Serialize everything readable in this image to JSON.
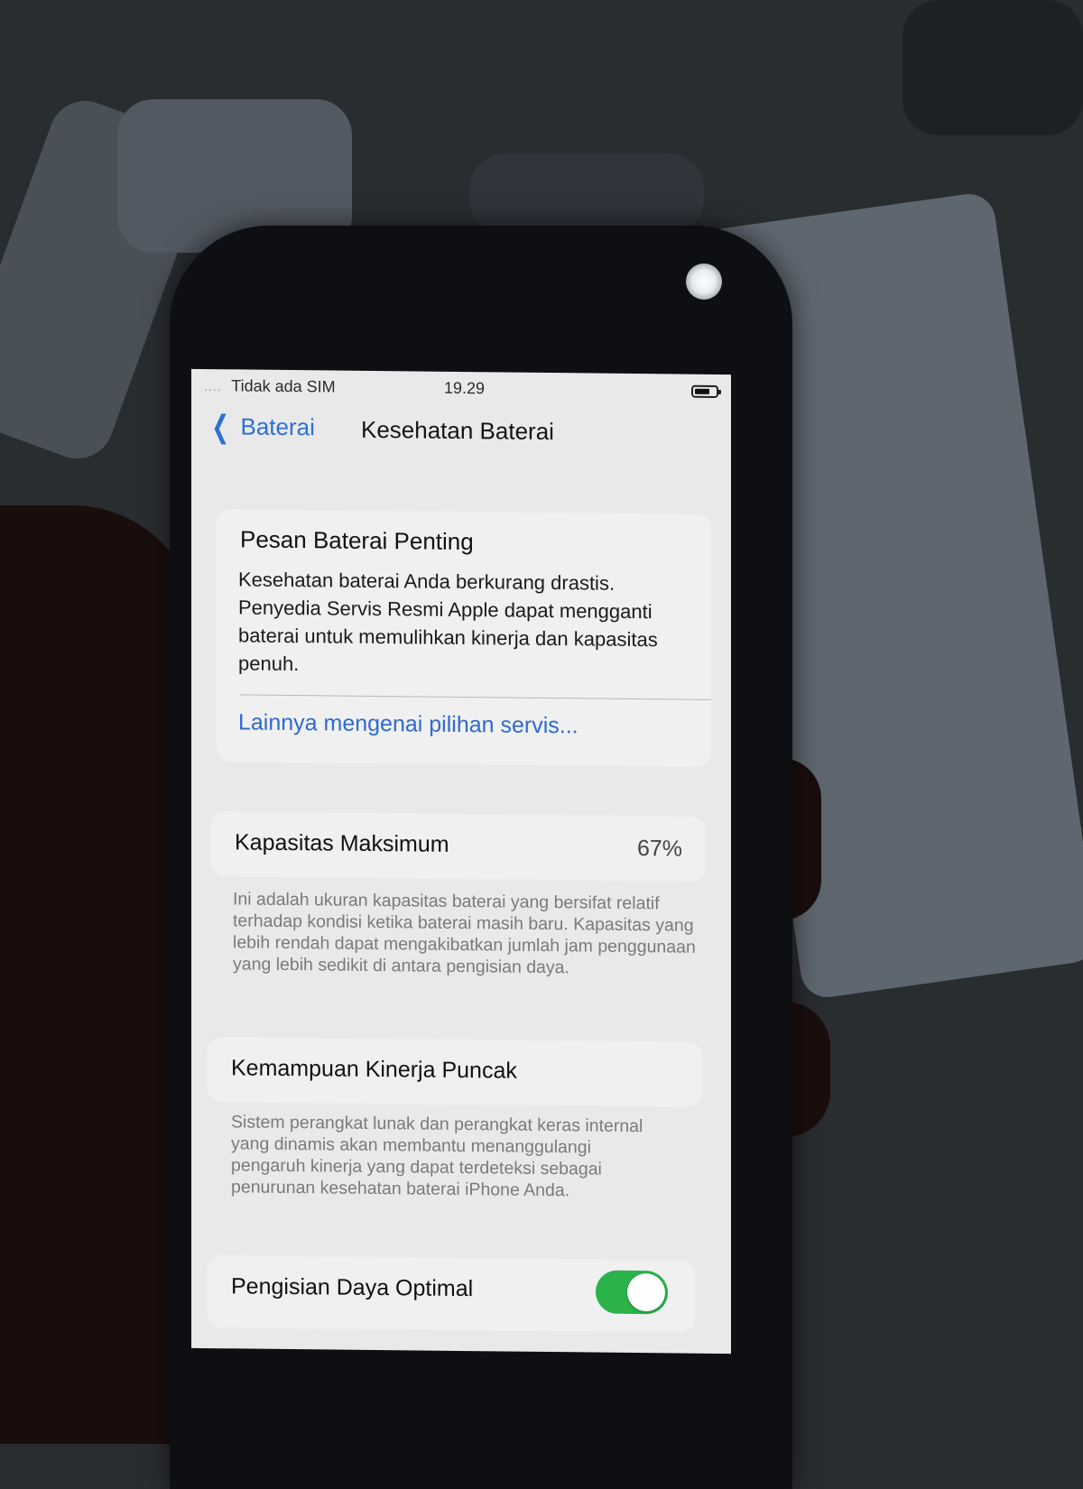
{
  "status_bar": {
    "signal": "....",
    "carrier": "Tidak ada SIM",
    "time": "19.29",
    "battery_icon": "battery-icon"
  },
  "nav": {
    "back_label": "Baterai",
    "back_icon": "chevron-left-icon",
    "title": "Kesehatan Baterai"
  },
  "message_card": {
    "title": "Pesan Baterai Penting",
    "body": "Kesehatan baterai Anda berkurang drastis. Penyedia Servis Resmi Apple dapat mengganti baterai untuk memulihkan kinerja dan kapasitas penuh.",
    "link": "Lainnya mengenai pilihan servis..."
  },
  "max_capacity": {
    "label": "Kapasitas Maksimum",
    "value": "67%",
    "note": "Ini adalah ukuran kapasitas baterai yang bersifat relatif terhadap kondisi ketika baterai masih baru. Kapasitas yang lebih rendah dapat mengakibatkan jumlah jam penggunaan yang lebih sedikit di antara pengisian daya."
  },
  "peak_performance": {
    "label": "Kemampuan Kinerja Puncak",
    "note": "Sistem perangkat lunak dan perangkat keras internal yang dinamis akan membantu menanggulangi pengaruh kinerja yang dapat terdeteksi sebagai penurunan kesehatan baterai iPhone Anda."
  },
  "optimized_charging": {
    "label": "Pengisian Daya Optimal",
    "enabled": true,
    "toggle_color": "#2bb34a"
  },
  "colors": {
    "link": "#2f69d0",
    "screen_bg": "#e9e9ea",
    "card_bg": "#f0f0f1"
  }
}
